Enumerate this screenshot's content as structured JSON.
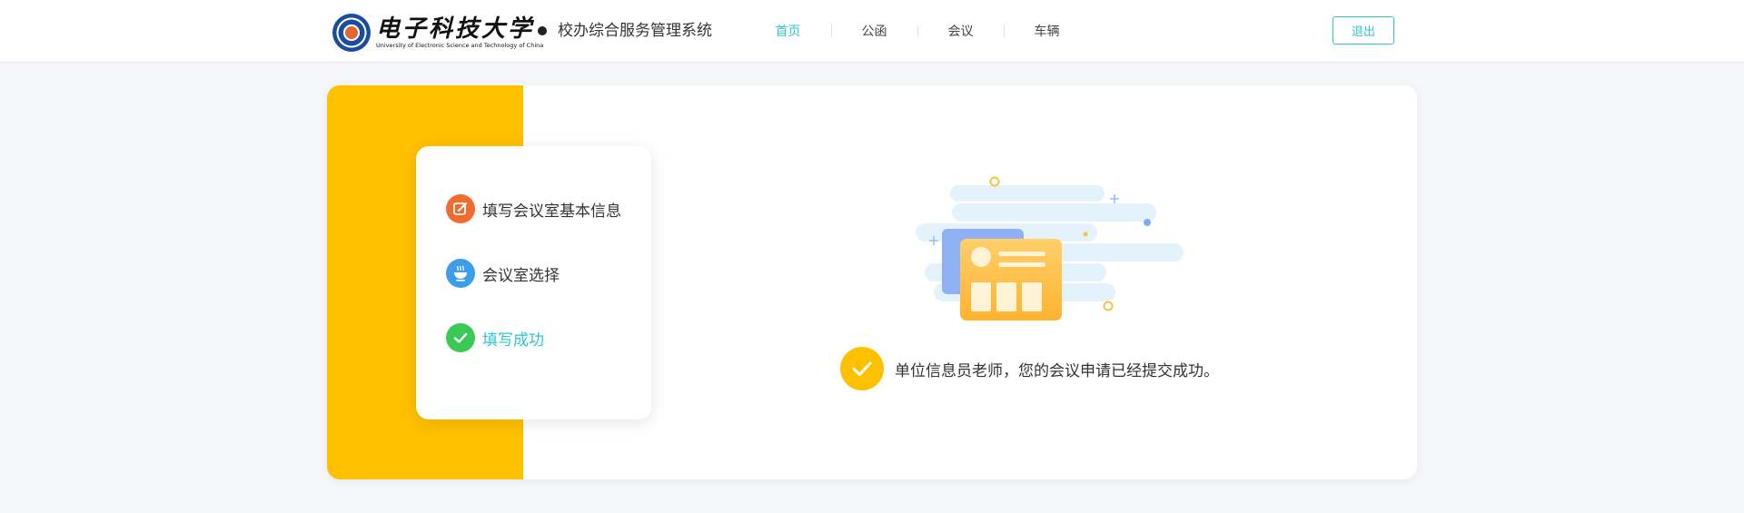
{
  "header": {
    "logo": {
      "name_cn": "电子科技大学",
      "name_en": "University of Electronic Science and Technology of China"
    },
    "system_title": "校办综合服务管理系统",
    "nav": [
      {
        "label": "首页",
        "active": true
      },
      {
        "label": "公函",
        "active": false
      },
      {
        "label": "会议",
        "active": false
      },
      {
        "label": "车辆",
        "active": false
      }
    ],
    "logout_label": "退出"
  },
  "steps": [
    {
      "label": "填写会议室基本信息",
      "icon": "edit-icon",
      "color": "#f26b2e",
      "state": "normal"
    },
    {
      "label": "会议室选择",
      "icon": "coffee-cup-icon",
      "color": "#3d9de8",
      "state": "normal"
    },
    {
      "label": "填写成功",
      "icon": "check-circle-icon",
      "color": "#3cc858",
      "state": "done"
    }
  ],
  "result": {
    "message": "单位信息员老师，您的会议申请已经提交成功。",
    "icon": "check-icon"
  },
  "colors": {
    "accent": "#2ec5cf",
    "yellow": "#ffc000",
    "background": "#f4f6fa"
  }
}
